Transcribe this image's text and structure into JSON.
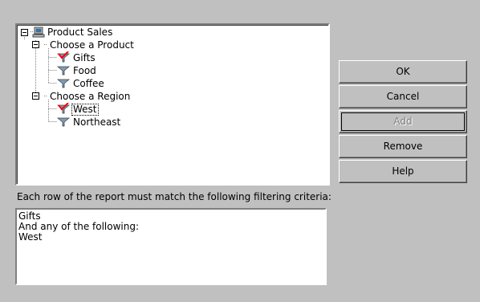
{
  "tree": {
    "root": {
      "label": "Product Sales",
      "icon": "database-icon"
    },
    "groups": [
      {
        "label": "Choose a Product",
        "items": [
          {
            "label": "Gifts",
            "icon": "filter-icon",
            "checked": true
          },
          {
            "label": "Food",
            "icon": "filter-icon",
            "checked": false
          },
          {
            "label": "Coffee",
            "icon": "filter-icon",
            "checked": false
          }
        ]
      },
      {
        "label": "Choose a Region",
        "items": [
          {
            "label": "West",
            "icon": "filter-icon",
            "checked": true,
            "selected": true
          },
          {
            "label": "Northeast",
            "icon": "filter-icon",
            "checked": false
          }
        ]
      }
    ]
  },
  "criteria": {
    "caption": "Each row of the report must match the following filtering criteria:",
    "lines": [
      "Gifts",
      "And any of the following:",
      "West"
    ]
  },
  "buttons": {
    "ok": "OK",
    "cancel": "Cancel",
    "add": "Add",
    "remove": "Remove",
    "help": "Help"
  },
  "colors": {
    "check": "#ff0000",
    "funnel": "#6a8aa8",
    "background": "#c0c0c0"
  }
}
